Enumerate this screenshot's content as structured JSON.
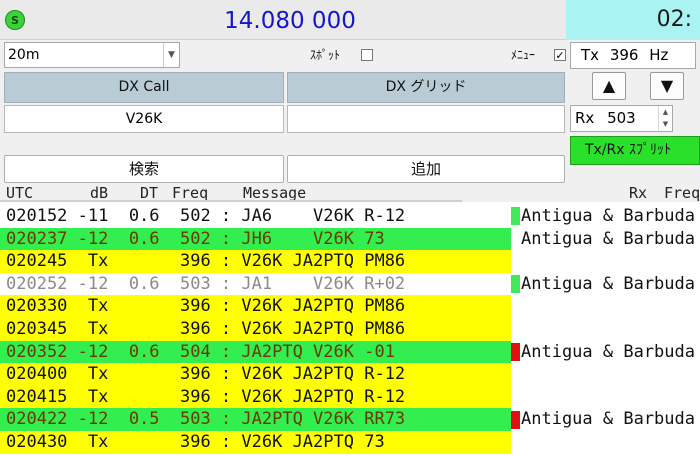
{
  "colors": {
    "green_row": "#33ee4f",
    "yellow_row": "#ffff00",
    "white_row": "#ffffff",
    "mark_green": "#41e85a",
    "mark_red": "#e01010",
    "dark_text": "#111111",
    "olive_text": "#6b3a00",
    "grey_text": "#8a8a8a"
  },
  "header": {
    "s_icon": "S",
    "frequency": "14.080 000",
    "clock": "02:"
  },
  "controls": {
    "band": "20m",
    "spot_label": "ｽﾎﾟｯﾄ",
    "menu_label": "ﾒﾆｭｰ",
    "menu_check": "✓",
    "tx_label": "Tx",
    "tx_value": "396",
    "tx_unit": "Hz",
    "up_arrow": "▲",
    "down_arrow": "▼",
    "rx_label": "Rx",
    "rx_value": "503",
    "split_label": "Tx/Rx ｽﾌﾟﾘｯﾄ"
  },
  "dx": {
    "call_header": "DX Call",
    "call_value": "V26K",
    "grid_header": "DX グリッド",
    "grid_value": ""
  },
  "buttons": {
    "search": "検索",
    "add": "追加"
  },
  "table": {
    "headers": {
      "utc": "UTC",
      "db": "dB",
      "dt": "DT",
      "freq": "Freq",
      "message": "Message",
      "rx": "Rx",
      "freq2": "Freq"
    },
    "rows": [
      {
        "text": "020152 -11  0.6  502 : JA6    V26K R-12",
        "bg": "white",
        "color": "dark",
        "mark": "green",
        "country": "Antigua & Barbuda"
      },
      {
        "text": "020237 -12  0.6  502 : JH6    V26K 73",
        "bg": "green",
        "color": "olive",
        "mark": "",
        "country": "Antigua & Barbuda"
      },
      {
        "text": "020245  Tx       396 : V26K JA2PTQ PM86",
        "bg": "yellow",
        "color": "dark",
        "mark": "",
        "country": ""
      },
      {
        "text": "020252 -12  0.6  503 : JA1    V26K R+02",
        "bg": "white",
        "color": "grey",
        "mark": "green",
        "country": "Antigua & Barbuda"
      },
      {
        "text": "020330  Tx       396 : V26K JA2PTQ PM86",
        "bg": "yellow",
        "color": "dark",
        "mark": "",
        "country": ""
      },
      {
        "text": "020345  Tx       396 : V26K JA2PTQ PM86",
        "bg": "yellow",
        "color": "dark",
        "mark": "",
        "country": ""
      },
      {
        "text": "020352 -12  0.6  504 : JA2PTQ V26K -01",
        "bg": "green",
        "color": "olive",
        "mark": "red",
        "country": "Antigua & Barbuda"
      },
      {
        "text": "020400  Tx       396 : V26K JA2PTQ R-12",
        "bg": "yellow",
        "color": "dark",
        "mark": "",
        "country": ""
      },
      {
        "text": "020415  Tx       396 : V26K JA2PTQ R-12",
        "bg": "yellow",
        "color": "dark",
        "mark": "",
        "country": ""
      },
      {
        "text": "020422 -12  0.5  503 : JA2PTQ V26K RR73",
        "bg": "green",
        "color": "olive",
        "mark": "red",
        "country": "Antigua & Barbuda"
      },
      {
        "text": "020430  Tx       396 : V26K JA2PTQ 73",
        "bg": "yellow",
        "color": "dark",
        "mark": "",
        "country": ""
      }
    ]
  }
}
